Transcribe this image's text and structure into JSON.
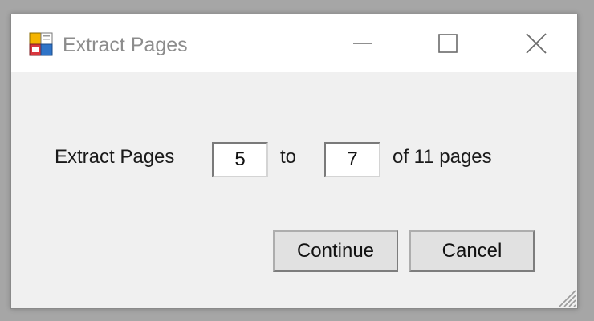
{
  "window": {
    "title": "Extract Pages",
    "icons": {
      "app": "app-icon",
      "minimize": "minimize-icon",
      "maximize": "maximize-icon",
      "close": "close-icon",
      "resize": "resize-grip-icon"
    }
  },
  "form": {
    "extract_label": "Extract Pages",
    "from_value": "5",
    "to_label": "to",
    "to_value": "7",
    "of_label": "of 11 pages"
  },
  "buttons": {
    "continue_label": "Continue",
    "cancel_label": "Cancel"
  },
  "colors": {
    "titlebar_bg": "#ffffff",
    "client_bg": "#f0f0f0",
    "title_text": "#8c8c8c",
    "button_face": "#e1e1e1"
  }
}
